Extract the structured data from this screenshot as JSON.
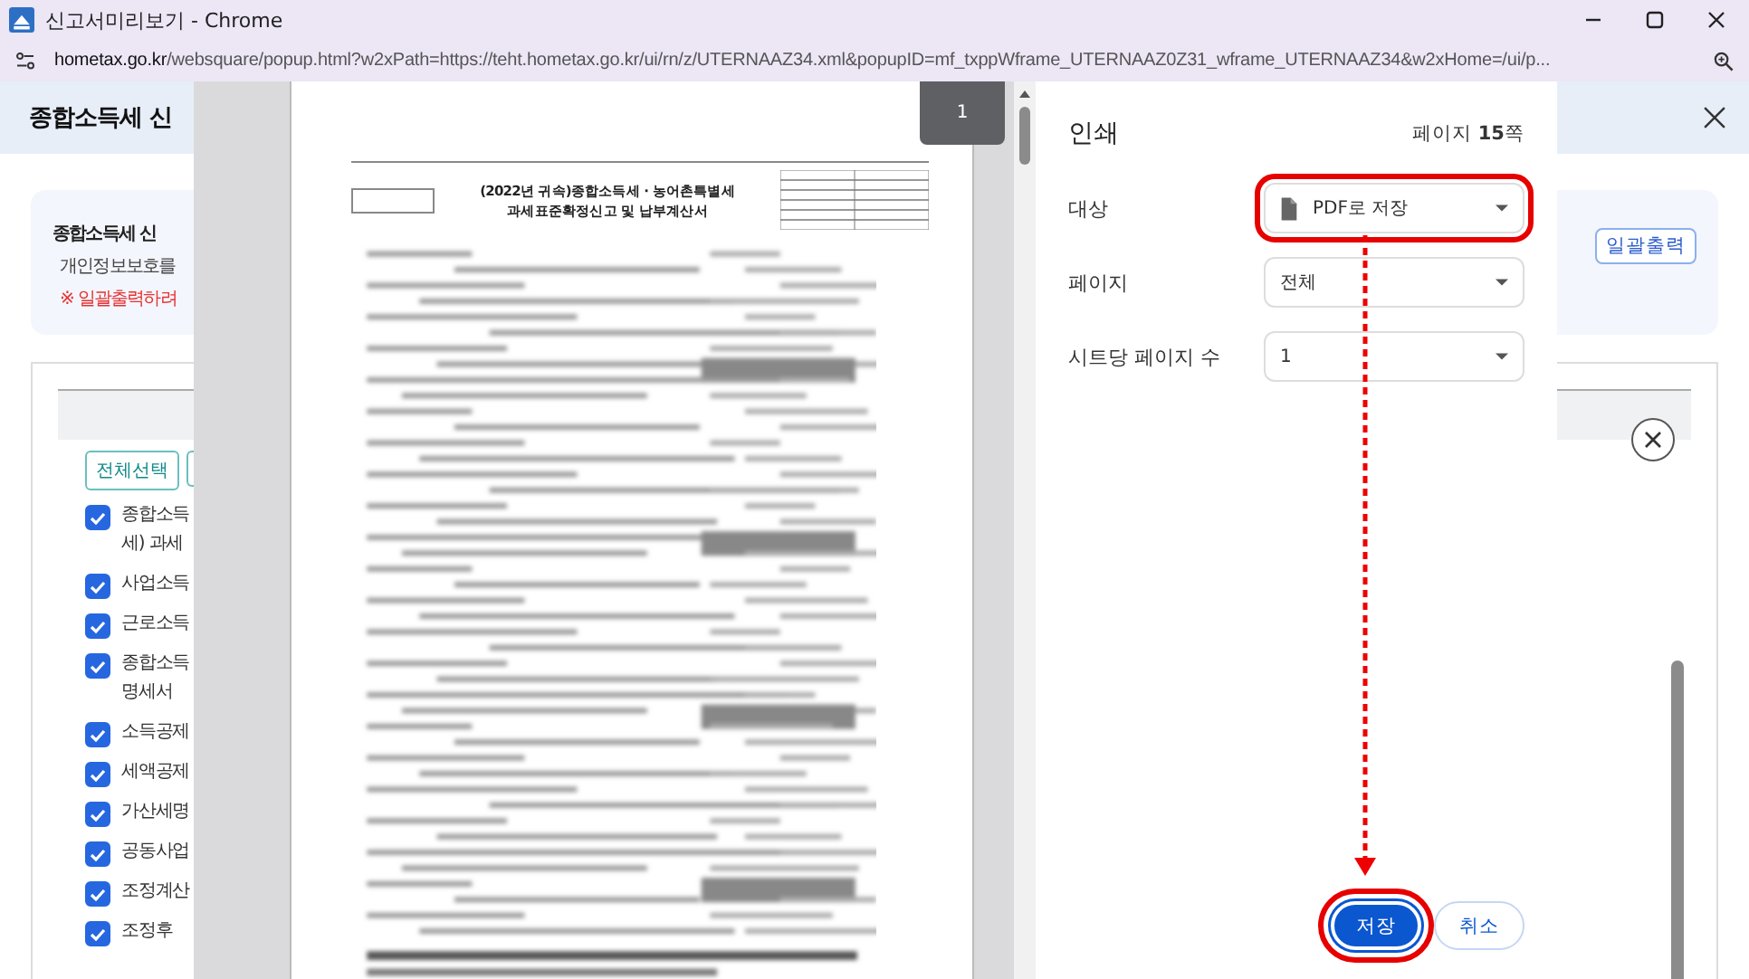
{
  "window": {
    "title": "신고서미리보기 - Chrome"
  },
  "address_bar": {
    "host": "hometax.go.kr",
    "path": "/websquare/popup.html?w2xPath=https://teht.hometax.go.kr/ui/rn/z/UTERNAAZ34.xml&popupID=mf_txppWframe_UTERNAAZ0Z31_wframe_UTERNAAZ34&w2xHome=/ui/p..."
  },
  "background_page": {
    "title": "종합소득세 신",
    "notice": [
      {
        "kind": "bullet",
        "text": "종합소득세 신"
      },
      {
        "kind": "dash",
        "text": "개인정보보호를"
      },
      {
        "kind": "warning",
        "text": "※ 일괄출력하려"
      }
    ],
    "batch_print_button": "일괄출력",
    "select_all_button": "전체선택",
    "items": [
      {
        "lines": [
          "종합소득",
          "세) 과세"
        ],
        "checked": true
      },
      {
        "lines": [
          "사업소득"
        ],
        "checked": true
      },
      {
        "lines": [
          "근로소득"
        ],
        "checked": true
      },
      {
        "lines": [
          "종합소득",
          "명세서"
        ],
        "checked": true
      },
      {
        "lines": [
          "소득공제"
        ],
        "checked": true
      },
      {
        "lines": [
          "세액공제"
        ],
        "checked": true
      },
      {
        "lines": [
          "가산세명"
        ],
        "checked": true
      },
      {
        "lines": [
          "공동사업"
        ],
        "checked": true
      },
      {
        "lines": [
          "조정계산"
        ],
        "checked": true
      },
      {
        "lines": [
          "조정후"
        ],
        "checked": true
      }
    ]
  },
  "preview": {
    "page_badge": "1",
    "document_title": [
      "(2022년 귀속)종합소득세 · 농어촌특별세",
      "과세표준확정신고 및 납부계산서"
    ]
  },
  "print_panel": {
    "title": "인쇄",
    "page_count": "페이지 **15**쪽",
    "settings": [
      {
        "label": "대상",
        "value": "PDF로 저장",
        "kind": "destination",
        "highlighted": true
      },
      {
        "label": "페이지",
        "value": "전체",
        "kind": "plain",
        "highlighted": false
      },
      {
        "label": "시트당 페이지 수",
        "value": "1",
        "kind": "plain",
        "highlighted": false
      }
    ],
    "buttons": [
      {
        "label": "저장",
        "kind": "primary",
        "highlighted": true
      },
      {
        "label": "취소",
        "kind": "secondary",
        "highlighted": false
      }
    ]
  }
}
